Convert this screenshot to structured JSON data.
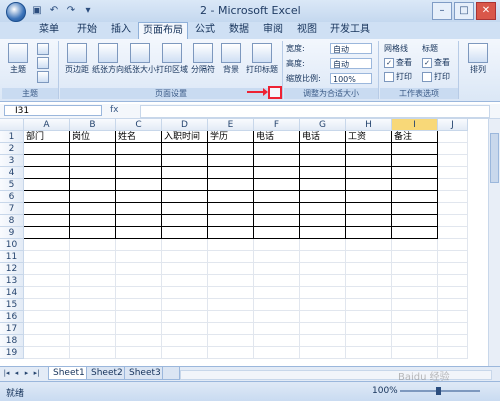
{
  "window": {
    "title": "2 - Microsoft Excel"
  },
  "tabs": [
    "菜单",
    "开始",
    "插入",
    "页面布局",
    "公式",
    "数据",
    "审阅",
    "视图",
    "开发工具"
  ],
  "active_tab": "页面布局",
  "ribbon": {
    "theme_group": {
      "label": "主题",
      "theme_btn": "主题"
    },
    "page_setup_group": {
      "label": "页面设置",
      "buttons": [
        "页边距",
        "纸张方向",
        "纸张大小",
        "打印区域",
        "分隔符",
        "背景",
        "打印标题"
      ]
    },
    "fit_group": {
      "label": "调整为合适大小",
      "width_label": "宽度:",
      "width_value": "自动",
      "height_label": "高度:",
      "height_value": "自动",
      "scale_label": "缩放比例:",
      "scale_value": "100%"
    },
    "sheet_options_group": {
      "label": "工作表选项",
      "gridlines": "网格线",
      "headings": "标题",
      "view": "查看",
      "print": "打印"
    },
    "arrange": "排列"
  },
  "name_box": "I31",
  "formula_value": "",
  "columns": [
    "A",
    "B",
    "C",
    "D",
    "E",
    "F",
    "G",
    "H",
    "I",
    "J"
  ],
  "selected_column": "I",
  "rows": [
    "1",
    "2",
    "3",
    "4",
    "5",
    "6",
    "7",
    "8",
    "9",
    "10",
    "11",
    "12",
    "13",
    "14",
    "15",
    "16",
    "17",
    "18",
    "19"
  ],
  "headers": [
    "部门",
    "岗位",
    "姓名",
    "入职时间",
    "学历",
    "电话",
    "电话",
    "工资",
    "备注"
  ],
  "sheets": [
    "Sheet1",
    "Sheet2",
    "Sheet3"
  ],
  "active_sheet": "Sheet1",
  "status": "就绪",
  "zoom": "100%",
  "watermark": "Baidu 经验"
}
